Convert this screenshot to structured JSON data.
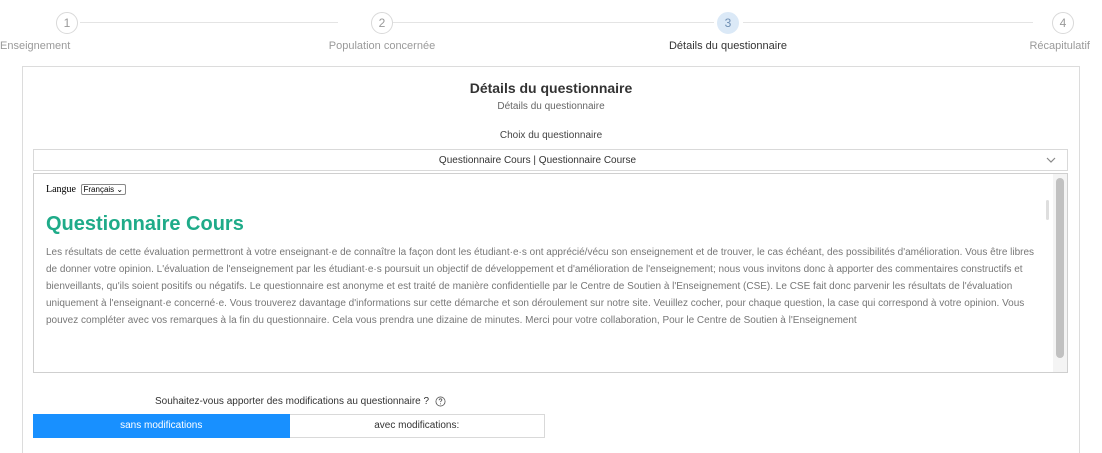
{
  "stepper": {
    "steps": [
      {
        "number": "1",
        "label": "Enseignement",
        "active": false
      },
      {
        "number": "2",
        "label": "Population concernée",
        "active": false
      },
      {
        "number": "3",
        "label": "Détails du questionnaire",
        "active": true
      },
      {
        "number": "4",
        "label": "Récapitulatif",
        "active": false
      }
    ]
  },
  "panel": {
    "title": "Détails du questionnaire",
    "subtitle": "Détails du questionnaire",
    "choice_label": "Choix du questionnaire",
    "select_value": "Questionnaire Cours | Questionnaire Course"
  },
  "preview": {
    "language_label": "Langue",
    "language_value": "Français",
    "title": "Questionnaire Cours",
    "description": "Les résultats de cette évaluation permettront à votre enseignant·e de connaître la façon dont les étudiant·e·s ont apprécié/vécu son enseignement et de trouver, le cas échéant, des possibilités d'amélioration. Vous être libres de donner votre opinion. L'évaluation de l'enseignement par les étudiant·e·s poursuit un objectif de développement et d'amélioration de l'enseignement; nous vous invitons donc à apporter des commentaires constructifs et bienveillants, qu'ils soient positifs ou négatifs. Le questionnaire est anonyme et est traité de manière confidentielle par le Centre de Soutien à l'Enseignement (CSE).  Le CSE fait donc parvenir les résultats de l'évaluation uniquement à l'enseignant·e concerné·e. Vous trouverez davantage d'informations sur cette démarche et son déroulement sur notre site. Veuillez cocher, pour chaque question, la case qui correspond à votre opinion. Vous pouvez compléter avec vos remarques à la fin du questionnaire. Cela vous prendra une dizaine de minutes. Merci pour votre collaboration, Pour le Centre de Soutien à l'Enseignement"
  },
  "modifications": {
    "question": "Souhaitez-vous apporter des modifications au questionnaire ?",
    "option_none": "sans modifications",
    "option_with": "avec modifications:"
  },
  "colors": {
    "accent": "#1890ff",
    "title_green": "#1fab89",
    "step_active_bg": "#dbe9f7"
  },
  "icons": [
    "chevron-down-icon",
    "help-circle-icon"
  ]
}
